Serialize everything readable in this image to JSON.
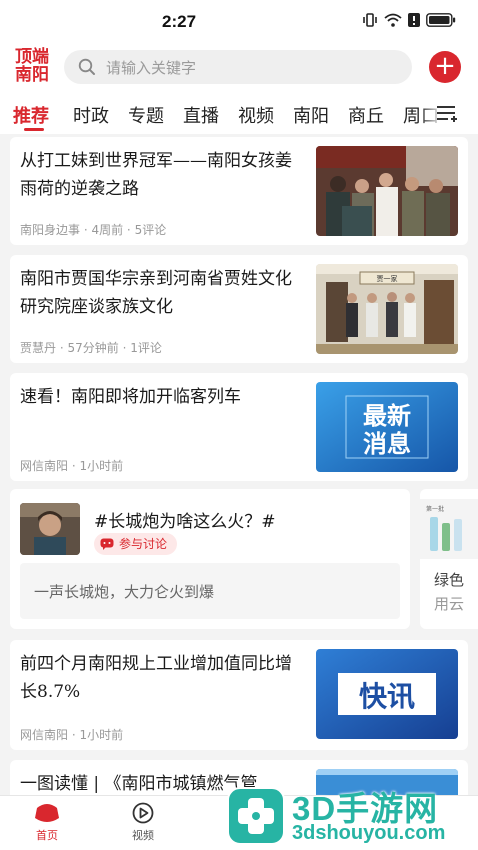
{
  "status_bar": {
    "time": "2:27"
  },
  "header": {
    "logo_line1": "顶端",
    "logo_line2": "南阳",
    "search_placeholder": "请输入关键字",
    "add_label": "+"
  },
  "tabs": [
    "推荐",
    "时政",
    "专题",
    "直播",
    "视频",
    "南阳",
    "商丘",
    "周口"
  ],
  "active_tab": "推荐",
  "articles": [
    {
      "title": "从打工妹到世界冠军——南阳女孩姜雨荷的逆袭之路",
      "source": "南阳身边事",
      "time": "4周前",
      "comments": "5评论"
    },
    {
      "title": "南阳市贾国华宗亲到河南省贾姓文化研究院座谈家族文化",
      "source": "贾慧丹",
      "time": "57分钟前",
      "comments": "1评论",
      "banner": "贾一家"
    },
    {
      "title": "速看！南阳即将加开临客列车",
      "source": "网信南阳",
      "time": "1小时前",
      "thumb_text_1": "最新",
      "thumb_text_2": "消息"
    },
    {
      "title": "前四个月南阳规上工业增加值同比增长8.7%",
      "source": "网信南阳",
      "time": "1小时前",
      "thumb_text": "快讯"
    },
    {
      "title": "一图读懂 | 《南阳市城镇燃气管"
    }
  ],
  "topic": {
    "title": "#长城炮为啥这么火？#",
    "badge": "参与讨论",
    "quote": "一声长城炮，大力仑火到爆"
  },
  "topic_peek": {
    "line1": "绿色",
    "line2": "用云",
    "header": "第一批"
  },
  "bottom_nav": [
    {
      "label": "首页",
      "active": true
    },
    {
      "label": "视频",
      "active": false
    }
  ],
  "watermark": {
    "title": "3D手游网",
    "url": "3dshouyou.com"
  },
  "colors": {
    "accent": "#d9272e",
    "watermark": "#27b4a4"
  }
}
